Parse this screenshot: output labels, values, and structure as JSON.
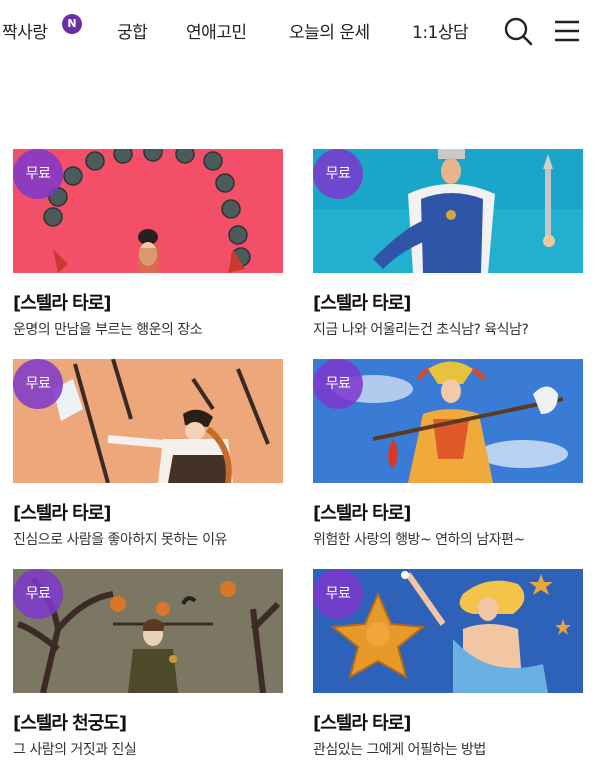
{
  "nav": {
    "items": [
      {
        "label": "짝사랑",
        "badge": "N"
      },
      {
        "label": "궁합"
      },
      {
        "label": "연애고민"
      },
      {
        "label": "오늘의 운세"
      },
      {
        "label": "1:1상담"
      }
    ],
    "search_icon": "search-icon",
    "menu_icon": "hamburger-menu-icon"
  },
  "cards": [
    {
      "badge": "무료",
      "title": "[스텔라 타로]",
      "desc": "운명의 만남을 부르는 행운의 장소"
    },
    {
      "badge": "무료",
      "title": "[스텔라 타로]",
      "desc": "지금 나와 어울리는건 초식남? 육식남?"
    },
    {
      "badge": "무료",
      "title": "[스텔라 타로]",
      "desc": "진심으로 사람을 좋아하지 못하는 이유"
    },
    {
      "badge": "무료",
      "title": "[스텔라 타로]",
      "desc": "위험한 사랑의 행방~ 연하의 남자편~"
    },
    {
      "badge": "무료",
      "title": "[스텔라 천궁도]",
      "desc": "그 사람의 거짓과 진실"
    },
    {
      "badge": "무료",
      "title": "[스텔라 타로]",
      "desc": "관심있는 그에게 어필하는 방법"
    }
  ],
  "colors": {
    "badge_purple": "#7d37cd",
    "n_badge": "#6a2ea6"
  }
}
